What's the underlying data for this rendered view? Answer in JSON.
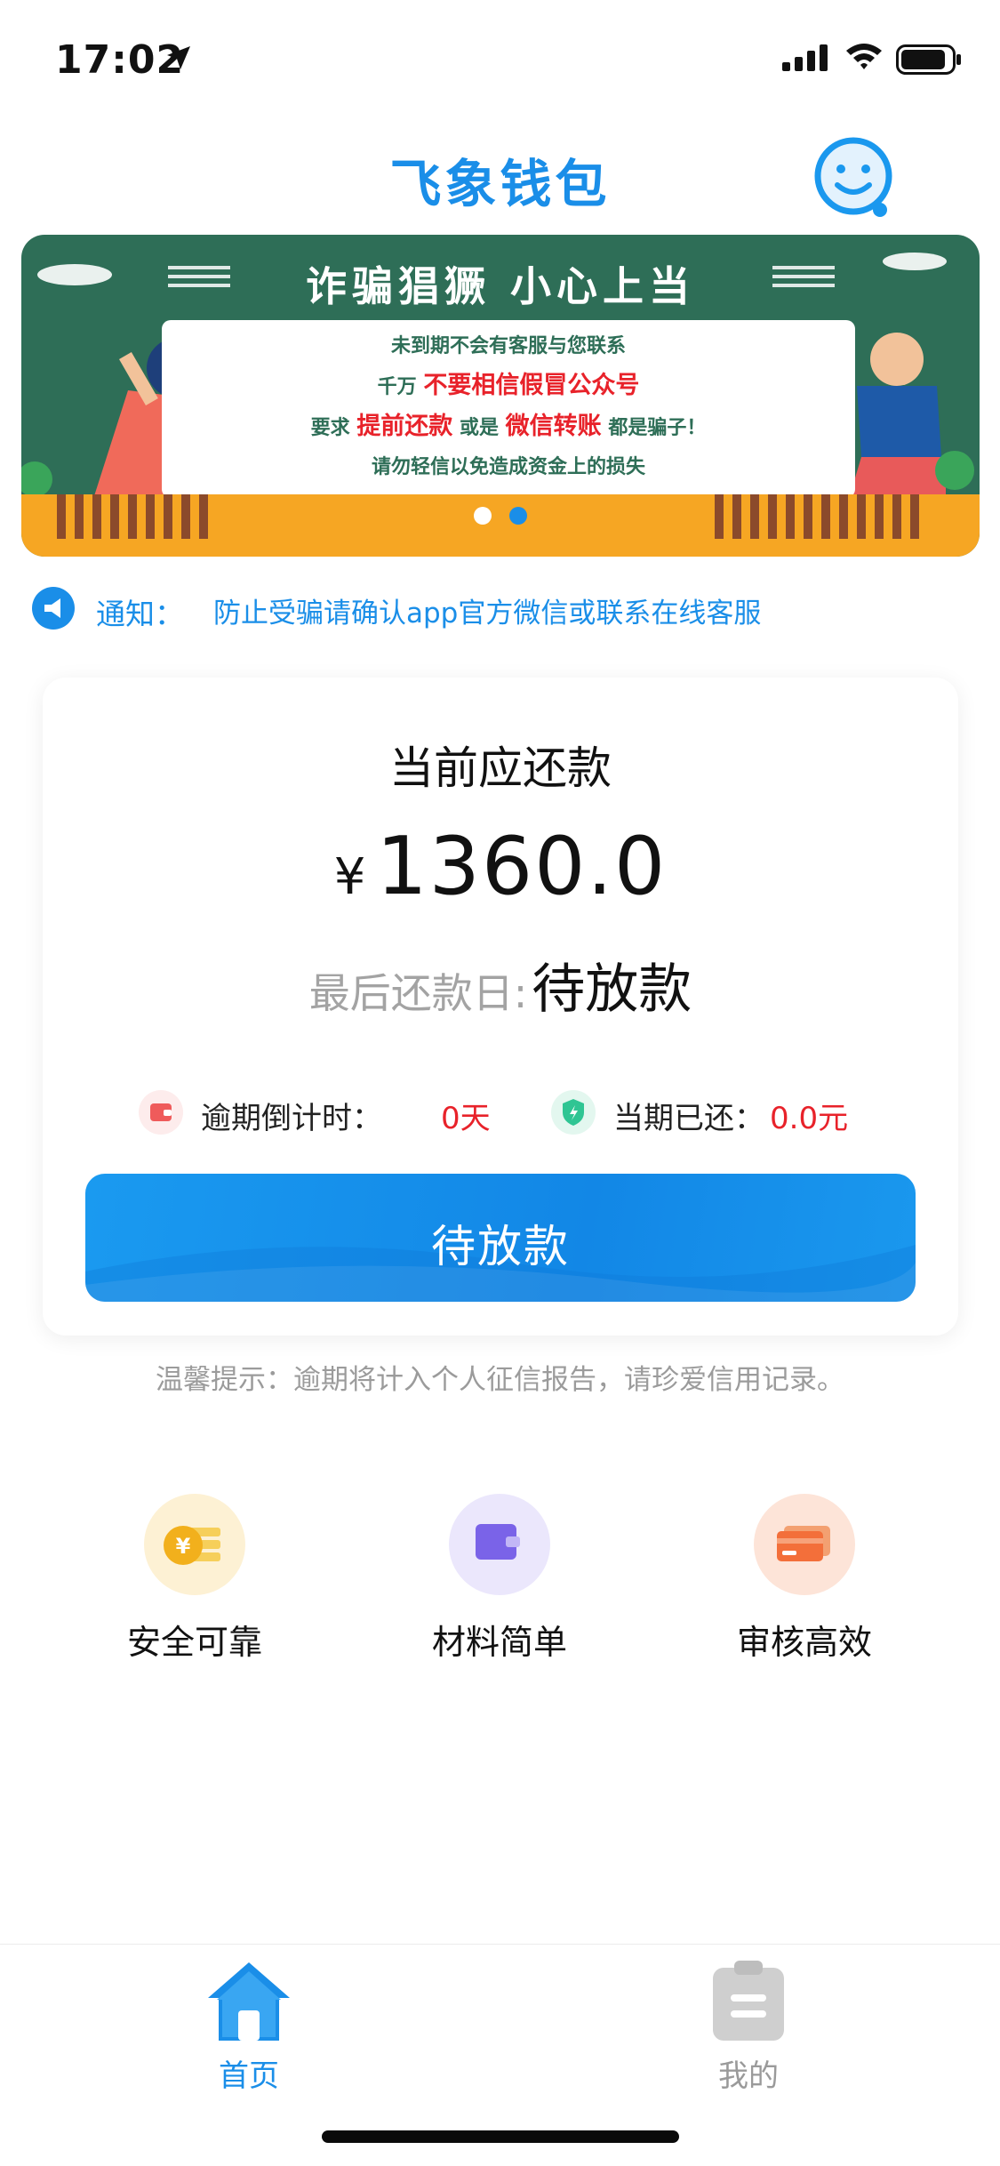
{
  "status_bar": {
    "time": "17:02"
  },
  "header": {
    "title": "飞象钱包"
  },
  "banner": {
    "headline": "诈骗猖獗 小心上当",
    "line1": "未到期不会有客服与您联系",
    "line2_a": "千万",
    "line2_b": "不要相信假冒公众号",
    "line3_a": "要求",
    "line3_b": "提前还款",
    "line3_c": "或是",
    "line3_d": "微信转账",
    "line3_e": "都是骗子！",
    "line4": "请勿轻信以免造成资金上的损失",
    "slide_count": 2,
    "active_slide": 2
  },
  "notice": {
    "label": "通知：",
    "text": "防止受骗请确认app官方微信或联系在线客服"
  },
  "repay": {
    "title": "当前应还款",
    "currency": "¥",
    "amount": "1360.0",
    "due_label": "最后还款日:",
    "due_value": "待放款",
    "overdue_label": "逾期倒计时：",
    "overdue_value": "0天",
    "paid_label": "当期已还：",
    "paid_value": "0.0元",
    "button_label": "待放款"
  },
  "tip": "温馨提示：逾期将计入个人征信报告，请珍爱信用记录。",
  "features": [
    {
      "label": "安全可靠",
      "icon": "coin-icon"
    },
    {
      "label": "材料简单",
      "icon": "wallet-icon"
    },
    {
      "label": "审核高效",
      "icon": "card-icon"
    }
  ],
  "tabs": [
    {
      "label": "首页",
      "icon": "home-icon",
      "active": true
    },
    {
      "label": "我的",
      "icon": "clipboard-icon",
      "active": false
    }
  ],
  "colors": {
    "accent": "#1a8ee8",
    "alert_red": "#e8222a",
    "muted": "#9b9b9b",
    "banner_green": "#2e6e57",
    "banner_orange": "#f6a623"
  }
}
